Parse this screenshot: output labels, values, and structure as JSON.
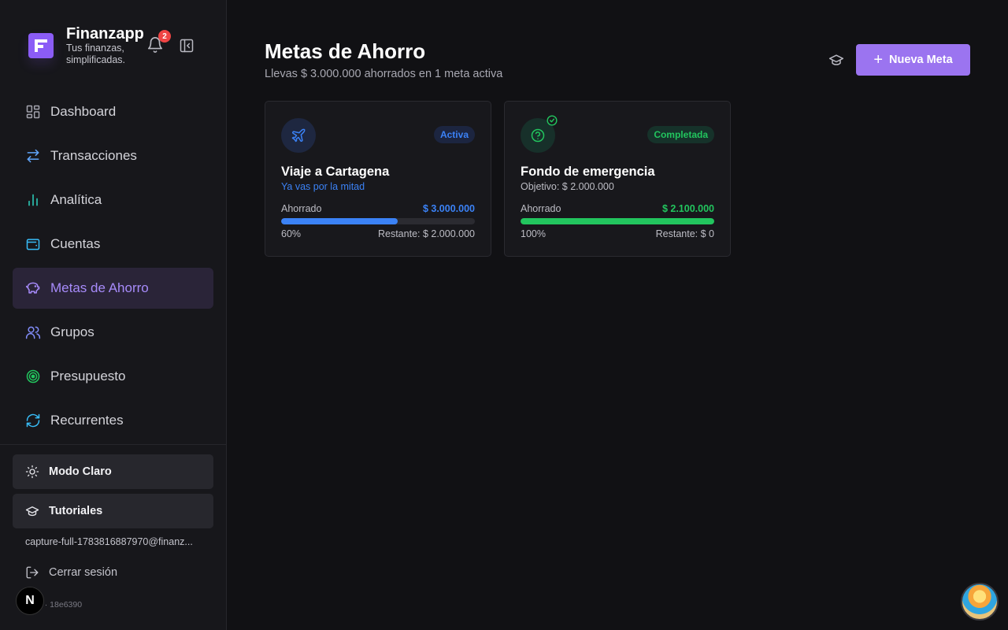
{
  "app": {
    "name": "Finanzapp",
    "tagline": "Tus finanzas, simplificadas.",
    "notifications_count": "2"
  },
  "sidebar": {
    "items": [
      {
        "label": "Dashboard",
        "icon": "dashboard-icon"
      },
      {
        "label": "Transacciones",
        "icon": "arrows-swap-icon"
      },
      {
        "label": "Analítica",
        "icon": "bar-chart-icon"
      },
      {
        "label": "Cuentas",
        "icon": "wallet-icon"
      },
      {
        "label": "Metas de Ahorro",
        "icon": "piggy-bank-icon",
        "active": true
      },
      {
        "label": "Grupos",
        "icon": "users-icon"
      },
      {
        "label": "Presupuesto",
        "icon": "target-icon"
      },
      {
        "label": "Recurrentes",
        "icon": "refresh-icon"
      }
    ],
    "theme_toggle": "Modo Claro",
    "tutorials": "Tutoriales",
    "user_email": "capture-full-1783816887970@finanz...",
    "logout": "Cerrar sesión",
    "version": "0 · 18e6390",
    "dev_badge": "N"
  },
  "main": {
    "title": "Metas de Ahorro",
    "subtitle": "Llevas $ 3.000.000 ahorrados en 1 meta activa",
    "new_button": "Nueva Meta",
    "goals": [
      {
        "icon": "plane-icon",
        "status": "Activa",
        "title": "Viaje a Cartagena",
        "subtitle": "Ya vas por la mitad",
        "saved_label": "Ahorrado",
        "saved_amount": "$ 3.000.000",
        "progress": 0.6,
        "percent": "60%",
        "remaining": "Restante: $ 2.000.000"
      },
      {
        "icon": "question-circle-icon",
        "status": "Completada",
        "title": "Fondo de emergencia",
        "subtitle": "Objetivo: $ 2.000.000",
        "saved_label": "Ahorrado",
        "saved_amount": "$ 2.100.000",
        "progress": 1.0,
        "percent": "100%",
        "remaining": "Restante: $ 0"
      }
    ]
  },
  "colors": {
    "accent": "#9b74f0",
    "active_blue": "#3b82f6",
    "complete_green": "#22c55e"
  }
}
